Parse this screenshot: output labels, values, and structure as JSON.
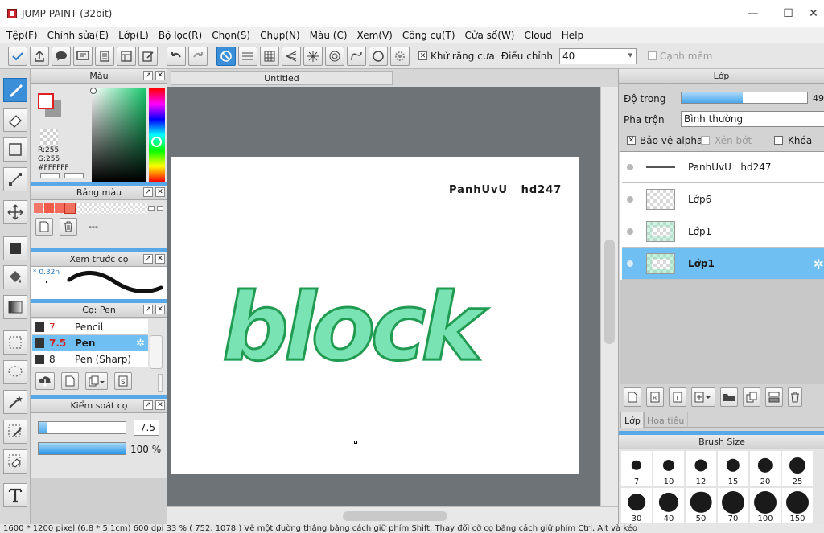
{
  "window": {
    "title": "JUMP PAINT (32bit)",
    "minimize": "—",
    "maximize": "☐",
    "close": "✕"
  },
  "menu": [
    "Tệp(F)",
    "Chỉnh sửa(E)",
    "Lớp(L)",
    "Bộ lọc(R)",
    "Chọn(S)",
    "Chụp(N)",
    "Màu (C)",
    "Xem(V)",
    "Công cụ(T)",
    "Cửa sổ(W)",
    "Cloud",
    "Help"
  ],
  "toolbar": {
    "antialias_label": "Khử răng cưa",
    "antialias_checked": "✕",
    "adjust_label": "Điều chỉnh",
    "adjust_value": "40",
    "soft_edge_label": "Cạnh mềm"
  },
  "color_panel": {
    "title": "Màu",
    "r_label": "R:255",
    "g_label": "G:255",
    "hex_label": "#FFFFFF"
  },
  "palette_panel": {
    "title": "Bảng màu",
    "swatches": [
      "#f2776a",
      "#f05a4a",
      "#f26b5c",
      "#f07060"
    ],
    "info": "---"
  },
  "preview_panel": {
    "title": "Xem trước cọ",
    "size_label": "* 0.32n"
  },
  "brush_panel": {
    "title": "Cọ: Pen",
    "items": [
      {
        "size": "7",
        "name": "Pencil"
      },
      {
        "size": "7.5",
        "name": "Pen"
      },
      {
        "size": "8",
        "name": "Pen (Sharp)"
      }
    ]
  },
  "brush_control": {
    "title": "Kiểm soát cọ",
    "size_value": "7.5",
    "opacity_value": "100 %",
    "size_fraction": 0.1,
    "opacity_fraction": 1.0
  },
  "document": {
    "tab_title": "Untitled",
    "text_top": "PanhUvU   hd247",
    "art_word": "block",
    "art_color": "#7ae3b4",
    "art_stroke": "#229b52"
  },
  "layers_panel": {
    "title": "Lớp",
    "opacity_label": "Độ trong",
    "opacity_value": "49",
    "opacity_fraction": 0.49,
    "blend_label": "Pha trộn",
    "blend_value": "Bình thường",
    "protect_alpha_label": "Bảo vệ alpha",
    "clip_label": "Xén bớt",
    "lock_label": "Khóa",
    "layers": [
      {
        "name": "PanhUvU   hd247"
      },
      {
        "name": "Lớp6"
      },
      {
        "name": "Lớp1"
      },
      {
        "name": "Lớp1"
      }
    ],
    "tab_layers": "Lớp",
    "tab_texture": "Hoa tiêu"
  },
  "brush_size_panel": {
    "title": "Brush Size",
    "sizes": [
      "7",
      "10",
      "12",
      "15",
      "20",
      "25",
      "30",
      "40",
      "50",
      "70",
      "100",
      "150"
    ]
  },
  "status": {
    "text": "1600 * 1200 pixel   (6.8 * 5.1cm)   600 dpi   33 %   ( 752, 1078 )   Vẽ một đường thẳng bằng cách giữ phím Shift. Thay đổi cỡ cọ bằng cách giữ phím Ctrl, Alt và kéo"
  }
}
